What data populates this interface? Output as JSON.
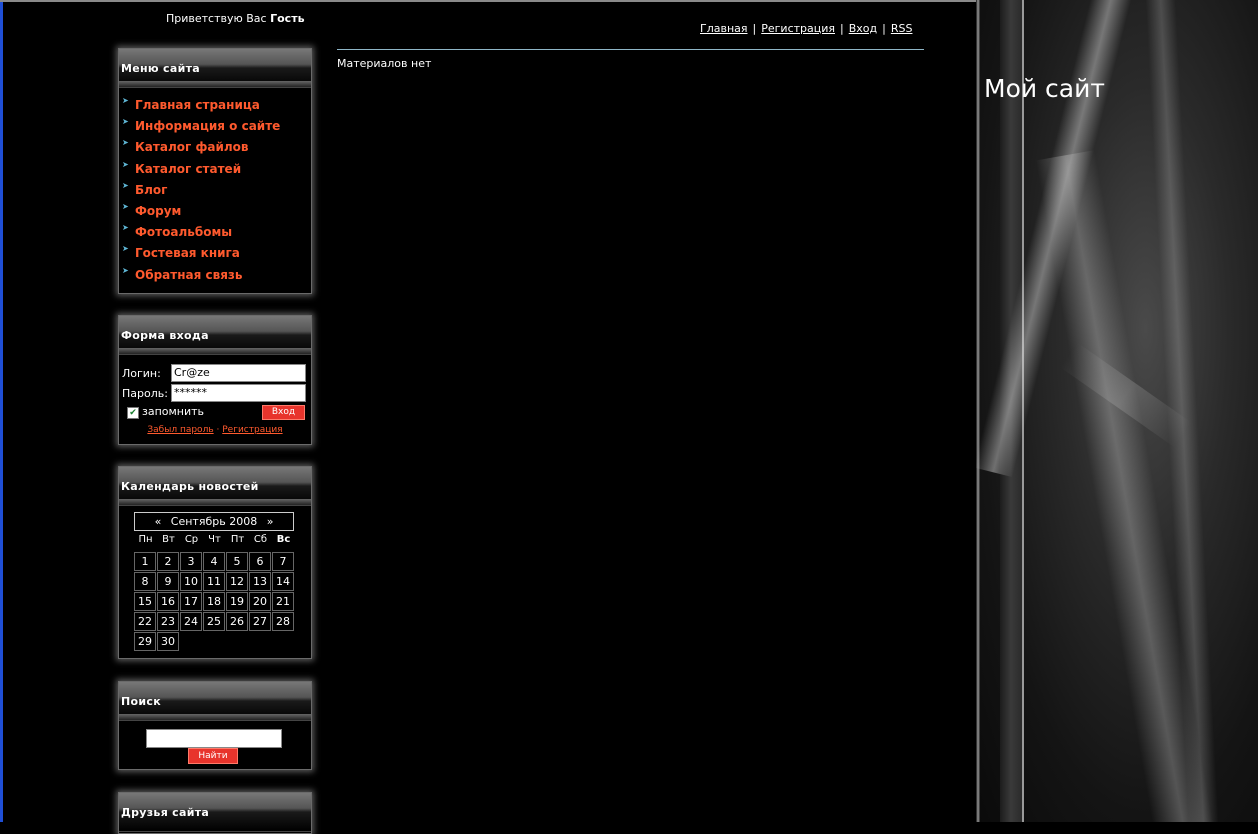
{
  "header": {
    "greeting_prefix": "Приветствую Вас",
    "greeting_user": "Гость",
    "site_title": "Мой сайт"
  },
  "topnav": {
    "items": [
      "Главная",
      "Регистрация",
      "Вход",
      "RSS"
    ]
  },
  "content": {
    "empty_text": "Материалов нет"
  },
  "menu_block": {
    "title": "Меню сайта",
    "items": [
      "Главная страница",
      "Информация о сайте",
      "Каталог файлов",
      "Каталог статей",
      "Блог",
      "Форум",
      "Фотоальбомы",
      "Гостевая книга",
      "Обратная связь"
    ]
  },
  "login_block": {
    "title": "Форма входа",
    "login_label": "Логин:",
    "login_value": "Cr@ze",
    "password_label": "Пароль:",
    "password_value": "******",
    "remember_label": "запомнить",
    "remember_checked": true,
    "submit_label": "Вход",
    "forgot_link": "Забыл пароль",
    "separator": "·",
    "register_link": "Регистрация"
  },
  "calendar_block": {
    "title": "Календарь новостей",
    "prev": "«",
    "month": "Сентябрь 2008",
    "next": "»",
    "weekdays": [
      "Пн",
      "Вт",
      "Ср",
      "Чт",
      "Пт",
      "Сб",
      "Вс"
    ],
    "days": [
      "1",
      "2",
      "3",
      "4",
      "5",
      "6",
      "7",
      "8",
      "9",
      "10",
      "11",
      "12",
      "13",
      "14",
      "15",
      "16",
      "17",
      "18",
      "19",
      "20",
      "21",
      "22",
      "23",
      "24",
      "25",
      "26",
      "27",
      "28",
      "29",
      "30"
    ]
  },
  "search_block": {
    "title": "Поиск",
    "input_value": "",
    "button_label": "Найти"
  },
  "friends_block": {
    "title": "Друзья сайта"
  },
  "colors": {
    "link": "#ff5a2e",
    "button": "#e8342c",
    "arrow": "#5fb7d6",
    "background": "#000000"
  }
}
